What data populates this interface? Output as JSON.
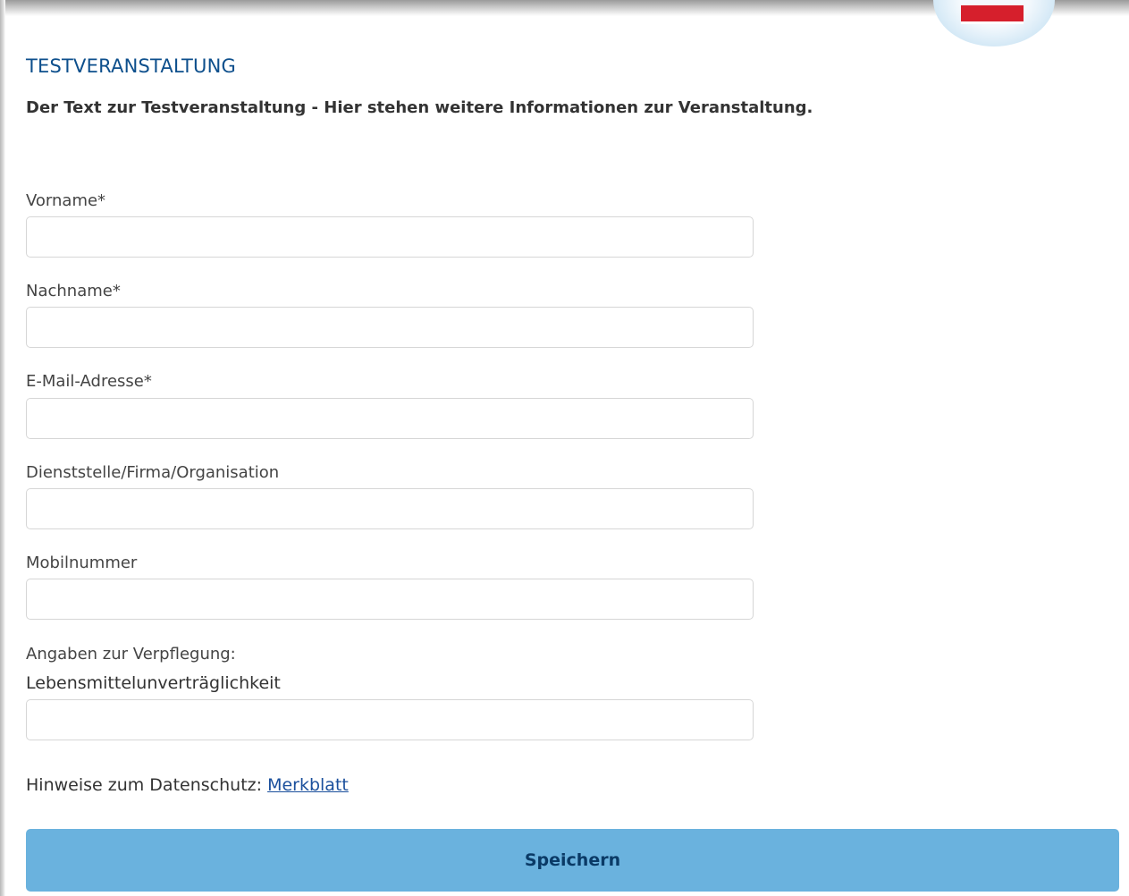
{
  "page": {
    "title": "TESTVERANSTALTUNG",
    "intro": "Der Text zur Testveranstaltung - Hier stehen weitere Informationen zur Veranstaltung."
  },
  "form": {
    "first_name": {
      "label": "Vorname*",
      "value": ""
    },
    "last_name": {
      "label": "Nachname*",
      "value": ""
    },
    "email": {
      "label": "E-Mail-Adresse*",
      "value": ""
    },
    "organization": {
      "label": "Dienststelle/Firma/Organisation",
      "value": ""
    },
    "mobile": {
      "label": "Mobilnummer",
      "value": ""
    },
    "catering_heading": "Angaben zur Verpflegung:",
    "food_intolerance": {
      "label": "Lebensmittelunverträglichkeit",
      "value": ""
    }
  },
  "privacy": {
    "text": "Hinweise zum Datenschutz:",
    "link_label": "Merkblatt"
  },
  "actions": {
    "save_label": "Speichern"
  },
  "colors": {
    "title": "#0d4f8c",
    "button": "#6ab2de",
    "button_text": "#0a3a66",
    "link": "#1a4f9c",
    "logo_red": "#d61f2c"
  }
}
